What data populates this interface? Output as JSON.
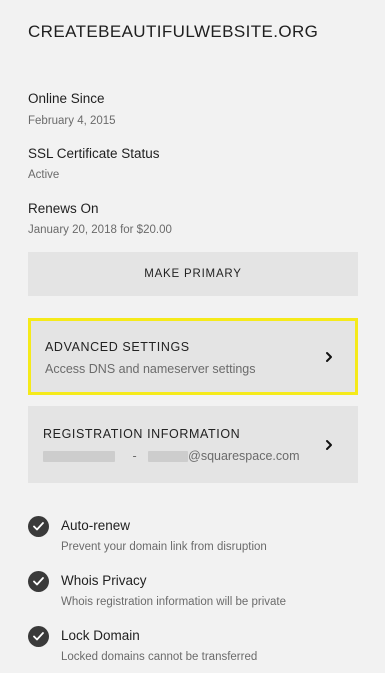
{
  "domain": {
    "name": "CREATEBEAUTIFULWEBSITE.ORG"
  },
  "info": {
    "online_since_label": "Online Since",
    "online_since_value": "February 4, 2015",
    "ssl_label": "SSL Certificate Status",
    "ssl_value": "Active",
    "renews_label": "Renews On",
    "renews_value": "January 20, 2018 for $20.00"
  },
  "actions": {
    "make_primary_label": "MAKE PRIMARY"
  },
  "cards": {
    "advanced": {
      "title": "ADVANCED SETTINGS",
      "subtitle": "Access DNS and nameserver settings"
    },
    "registration": {
      "title": "REGISTRATION INFORMATION",
      "separator": "-",
      "email_suffix": "@squarespace.com"
    }
  },
  "features": [
    {
      "label": "Auto-renew",
      "description": "Prevent your domain link from disruption",
      "checked": true
    },
    {
      "label": "Whois Privacy",
      "description": "Whois registration information will be private",
      "checked": true
    },
    {
      "label": "Lock Domain",
      "description": "Locked domains cannot be transferred",
      "checked": true
    }
  ],
  "colors": {
    "background": "#f2f2f2",
    "card": "#e4e4e4",
    "highlight": "#f5ea1a",
    "check": "#3a3a3a",
    "muted_text": "#6b6b6b"
  }
}
